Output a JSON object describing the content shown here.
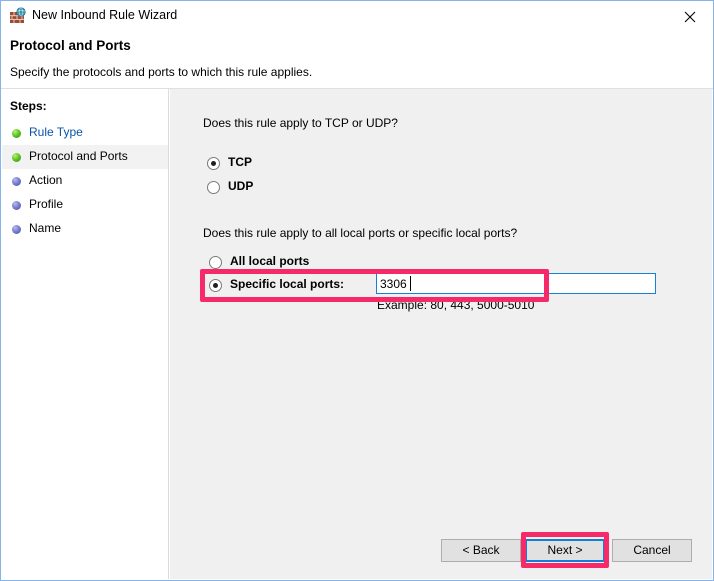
{
  "window": {
    "title": "New Inbound Rule Wizard",
    "icon": "firewall-globe-icon",
    "close_label": "✕",
    "border_color": "#84b4ea"
  },
  "header": {
    "title": "Protocol and Ports",
    "subtitle": "Specify the protocols and ports to which this rule applies."
  },
  "sidebar": {
    "heading": "Steps:",
    "items": [
      {
        "label": "Rule Type",
        "state": "done",
        "bullet": "green"
      },
      {
        "label": "Protocol and Ports",
        "state": "current",
        "bullet": "green"
      },
      {
        "label": "Action",
        "state": "pending",
        "bullet": "blue"
      },
      {
        "label": "Profile",
        "state": "pending",
        "bullet": "blue"
      },
      {
        "label": "Name",
        "state": "pending",
        "bullet": "blue"
      }
    ]
  },
  "main": {
    "protocol": {
      "question": "Does this rule apply to TCP or UDP?",
      "options": [
        {
          "label": "TCP",
          "selected": true
        },
        {
          "label": "UDP",
          "selected": false
        }
      ]
    },
    "ports": {
      "question": "Does this rule apply to all local ports or specific local ports?",
      "options": [
        {
          "label": "All local ports",
          "selected": false
        },
        {
          "label": "Specific local ports:",
          "selected": true
        }
      ],
      "input_value": "3306",
      "input_placeholder": "",
      "example_text": "Example: 80, 443, 5000-5010"
    }
  },
  "footer": {
    "back_label": "< Back",
    "next_label": "Next >",
    "cancel_label": "Cancel"
  },
  "annotations": {
    "highlight_color": "#f72a69",
    "targets": [
      "specific-local-ports-row",
      "next-button"
    ]
  }
}
